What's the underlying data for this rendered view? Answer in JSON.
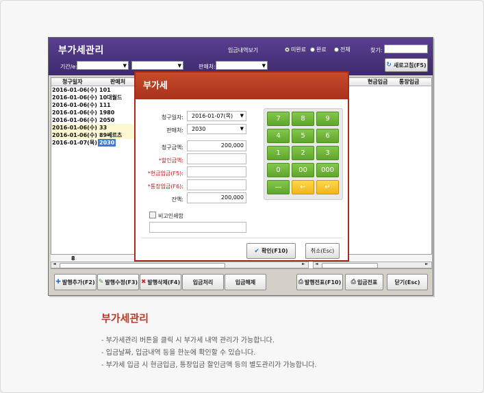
{
  "app": {
    "title": "부가세관리",
    "filters": {
      "period_label": "기간/e:",
      "seller_label": "판매처:",
      "payment_view_label": "입금내역보기",
      "radio_options": [
        "미완료",
        "완료",
        "전체"
      ],
      "radio_selected": "미완료",
      "search_label": "찾기:",
      "search_value": "",
      "refresh_label": "새로고침(F5)"
    },
    "grid": {
      "columns": [
        "청구일자",
        "판매처",
        "현금입금",
        "통장입금"
      ],
      "rows": [
        {
          "date": "2016-01-06(수)",
          "seller": "101"
        },
        {
          "date": "2016-01-06(수)",
          "seller": "10대월드"
        },
        {
          "date": "2016-01-06(수)",
          "seller": "111"
        },
        {
          "date": "2016-01-06(수)",
          "seller": "1980"
        },
        {
          "date": "2016-01-06(수)",
          "seller": "2050"
        },
        {
          "date": "2016-01-06(수)",
          "seller": "33"
        },
        {
          "date": "2016-01-06(수)",
          "seller": "89쎄르츠"
        },
        {
          "date": "2016-01-07(목)",
          "seller": "2030"
        }
      ],
      "summary_count": "8"
    },
    "toolbar": {
      "add": "발행추가(F2)",
      "edit": "발행수정(F3)",
      "delete": "발행삭제(F4)",
      "deposit": "입금처리",
      "cancel_deposit": "입금해제",
      "print_invoice": "발행전표(F10)",
      "print_deposit": "입금전표",
      "close": "닫기(Esc)"
    }
  },
  "dialog": {
    "title": "부가세",
    "fields": {
      "bill_date_label": "청구일자:",
      "bill_date": "2016-01-07(목)",
      "seller_label": "판매처:",
      "seller": "2030",
      "amount_label": "청구금액:",
      "amount": "200,000",
      "discount_label": "*할인금액:",
      "discount": "",
      "cash_label": "*현금입금(F5):",
      "cash": "",
      "bank_label": "*통장입금(F6):",
      "bank": "",
      "balance_label": "잔액:",
      "balance": "200,000"
    },
    "memo_checkbox": "비고인쇄함",
    "keypad": [
      "7",
      "8",
      "9",
      "4",
      "5",
      "6",
      "1",
      "2",
      "3",
      "0",
      "00",
      "000",
      "—",
      "←",
      "↵"
    ],
    "confirm": "확인(F10)",
    "cancel": "취소(Esc)"
  },
  "caption": {
    "title": "부가세관리",
    "lines": [
      "- 부가세관리 버튼을 클릭 시 부가세 내역 관리가 가능합니다.",
      "- 입금날짜, 입금내역 등을 한눈에 확인할 수 있습니다.",
      "- 부가세 입금 시 현금입금, 통장입금 할인금액 등의 별도관리가 가능합니다."
    ]
  },
  "colors": {
    "header": "#4a3380",
    "dialog_title": "#b83a22",
    "keypad_green": "#6db33a",
    "keypad_yellow": "#f5c22b",
    "caption_title": "#b53a2a"
  }
}
